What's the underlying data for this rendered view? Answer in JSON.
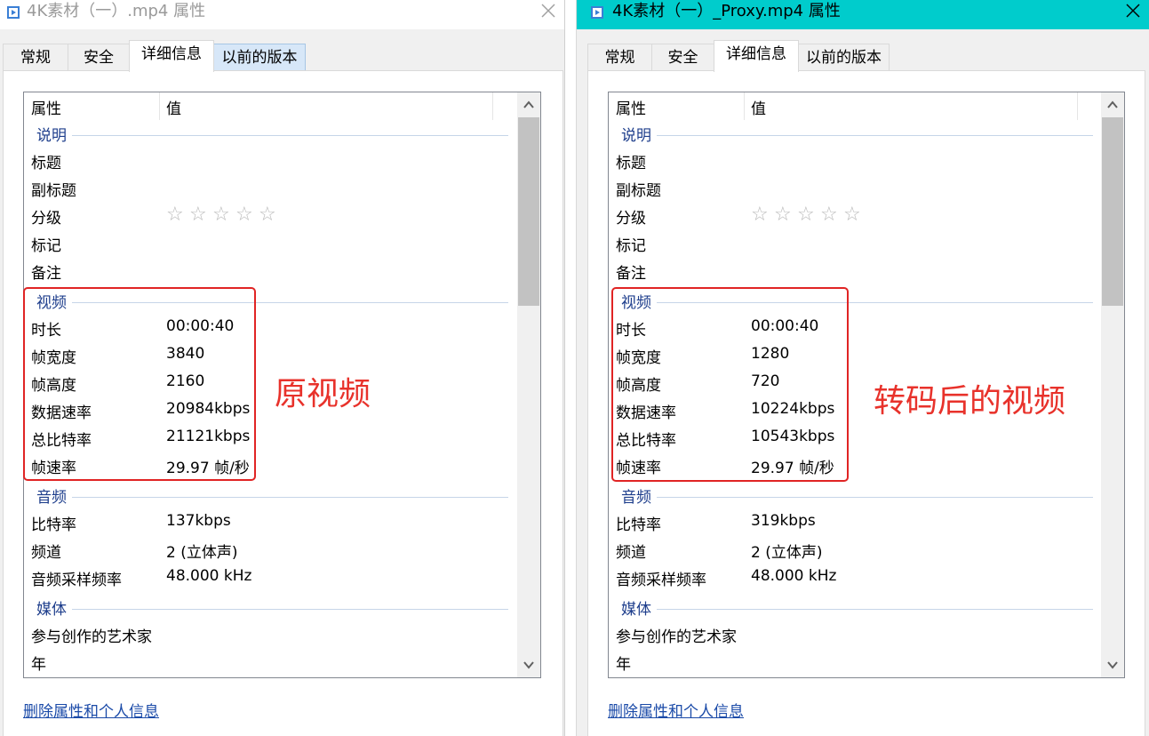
{
  "left": {
    "title": "4K素材（一）.mp4 属性",
    "tabs": [
      "常规",
      "安全",
      "详细信息",
      "以前的版本"
    ],
    "header": {
      "property": "属性",
      "value": "值"
    },
    "sections": {
      "description": "说明",
      "video": "视频",
      "audio": "音频",
      "media": "媒体"
    },
    "description_rows": [
      {
        "k": "标题",
        "v": ""
      },
      {
        "k": "副标题",
        "v": ""
      },
      {
        "k": "分级",
        "v": ""
      },
      {
        "k": "标记",
        "v": ""
      },
      {
        "k": "备注",
        "v": ""
      }
    ],
    "video_rows": [
      {
        "k": "时长",
        "v": "00:00:40"
      },
      {
        "k": "帧宽度",
        "v": "3840"
      },
      {
        "k": "帧高度",
        "v": "2160"
      },
      {
        "k": "数据速率",
        "v": "20984kbps"
      },
      {
        "k": "总比特率",
        "v": "21121kbps"
      },
      {
        "k": "帧速率",
        "v": "29.97 帧/秒"
      }
    ],
    "audio_rows": [
      {
        "k": "比特率",
        "v": "137kbps"
      },
      {
        "k": "频道",
        "v": "2 (立体声)"
      },
      {
        "k": "音频采样频率",
        "v": "48.000 kHz"
      }
    ],
    "media_rows": [
      {
        "k": "参与创作的艺术家",
        "v": ""
      },
      {
        "k": "年",
        "v": ""
      }
    ],
    "rating_stars": 0,
    "annotation": "原视频",
    "remove_link": "删除属性和个人信息"
  },
  "right": {
    "title": "4K素材（一）_Proxy.mp4 属性",
    "tabs": [
      "常规",
      "安全",
      "详细信息",
      "以前的版本"
    ],
    "header": {
      "property": "属性",
      "value": "值"
    },
    "sections": {
      "description": "说明",
      "video": "视频",
      "audio": "音频",
      "media": "媒体"
    },
    "description_rows": [
      {
        "k": "标题",
        "v": ""
      },
      {
        "k": "副标题",
        "v": ""
      },
      {
        "k": "分级",
        "v": ""
      },
      {
        "k": "标记",
        "v": ""
      },
      {
        "k": "备注",
        "v": ""
      }
    ],
    "video_rows": [
      {
        "k": "时长",
        "v": "00:00:40"
      },
      {
        "k": "帧宽度",
        "v": "1280"
      },
      {
        "k": "帧高度",
        "v": "720"
      },
      {
        "k": "数据速率",
        "v": "10224kbps"
      },
      {
        "k": "总比特率",
        "v": "10543kbps"
      },
      {
        "k": "帧速率",
        "v": "29.97 帧/秒"
      }
    ],
    "audio_rows": [
      {
        "k": "比特率",
        "v": "319kbps"
      },
      {
        "k": "频道",
        "v": "2 (立体声)"
      },
      {
        "k": "音频采样频率",
        "v": "48.000 kHz"
      }
    ],
    "media_rows": [
      {
        "k": "参与创作的艺术家",
        "v": ""
      },
      {
        "k": "年",
        "v": ""
      }
    ],
    "rating_stars": 0,
    "annotation": "转码后的视频",
    "remove_link": "删除属性和个人信息"
  },
  "colors": {
    "active_titlebar": "#00cccc",
    "annotation_red": "#e8322b",
    "section_blue": "#1e3e8c",
    "link_blue": "#1a4aa8"
  },
  "icons": {
    "app": "video-file-icon",
    "close": "close-icon",
    "scroll_up": "chevron-up-icon",
    "scroll_down": "chevron-down-icon",
    "rating": "star-outline-icon"
  }
}
